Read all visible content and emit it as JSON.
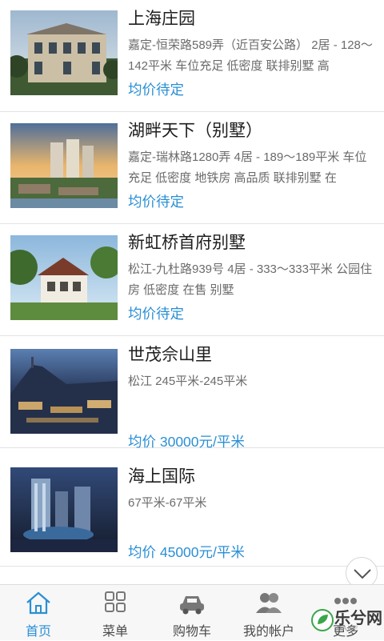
{
  "listings": [
    {
      "title": "上海庄园",
      "desc": "嘉定-恒荣路589弄（近百安公路） 2居 - 128～142平米 车位充足 低密度 联排别墅 高",
      "price": "均价待定",
      "image": "villa-estate-photo"
    },
    {
      "title": "湖畔天下（别墅）",
      "desc": "嘉定-瑞林路1280弄 4居 - 189～189平米 车位充足 低密度 地铁房 高品质 联排别墅 在",
      "price": "均价待定",
      "image": "lakeside-towers-photo"
    },
    {
      "title": "新虹桥首府别墅",
      "desc": "松江-九杜路939号 4居 - 333～333平米 公园住房 低密度 在售 别墅",
      "price": "均价待定",
      "image": "villa-garden-photo"
    },
    {
      "title": "世茂佘山里",
      "desc": "松江 245平米-245平米",
      "price": "均价 30000元/平米",
      "image": "hillside-night-photo"
    },
    {
      "title": "海上国际",
      "desc": "67平米-67平米",
      "price": "均价 45000元/平米",
      "image": "city-tower-night-photo"
    }
  ],
  "tabbar": {
    "items": [
      {
        "label": "首页",
        "icon": "home-icon",
        "active": true
      },
      {
        "label": "菜单",
        "icon": "grid-icon",
        "active": false
      },
      {
        "label": "购物车",
        "icon": "car-icon",
        "active": false
      },
      {
        "label": "我的帐户",
        "icon": "user-group-icon",
        "active": false
      },
      {
        "label": "更多",
        "icon": "more-dots-icon",
        "active": false
      }
    ]
  },
  "watermark": {
    "text": "乐兮网",
    "sub": "GAME"
  },
  "colors": {
    "accent": "#2a8fd4",
    "title": "#1d1d1d",
    "desc": "#6b6b6b",
    "divider": "#e3e3e3"
  }
}
